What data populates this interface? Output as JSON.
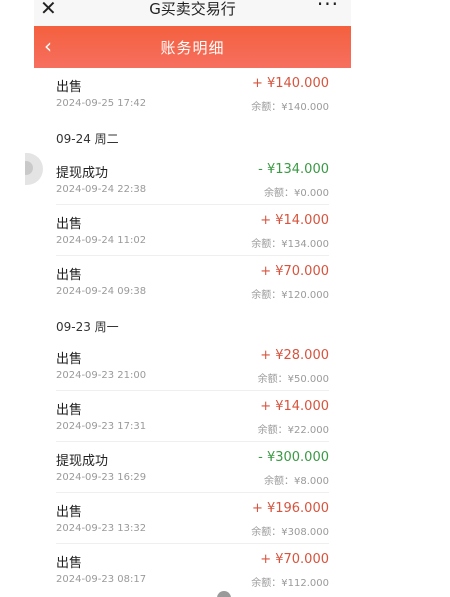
{
  "topbar": {
    "close_icon": "✕",
    "title": "G买卖交易行",
    "more_icon": "···"
  },
  "header": {
    "back_icon": "‹",
    "title": "账务明细"
  },
  "groups": [
    {
      "day": "",
      "records": [
        {
          "label": "出售",
          "date": "2024-09-25 17:42",
          "amount": "+ ¥140.000",
          "balance": "余额：¥140.000",
          "type": "in"
        }
      ]
    },
    {
      "day": "09-24 周二",
      "records": [
        {
          "label": "提现成功",
          "date": "2024-09-24 22:38",
          "amount": "- ¥134.000",
          "balance": "余额：¥0.000",
          "type": "out"
        },
        {
          "label": "出售",
          "date": "2024-09-24 11:02",
          "amount": "+ ¥14.000",
          "balance": "余额：¥134.000",
          "type": "in"
        },
        {
          "label": "出售",
          "date": "2024-09-24 09:38",
          "amount": "+ ¥70.000",
          "balance": "余额：¥120.000",
          "type": "in"
        }
      ]
    },
    {
      "day": "09-23 周一",
      "records": [
        {
          "label": "出售",
          "date": "2024-09-23 21:00",
          "amount": "+ ¥28.000",
          "balance": "余额：¥50.000",
          "type": "in"
        },
        {
          "label": "出售",
          "date": "2024-09-23 17:31",
          "amount": "+ ¥14.000",
          "balance": "余额：¥22.000",
          "type": "in"
        },
        {
          "label": "提现成功",
          "date": "2024-09-23 16:29",
          "amount": "- ¥300.000",
          "balance": "余额：¥8.000",
          "type": "out"
        },
        {
          "label": "出售",
          "date": "2024-09-23 13:32",
          "amount": "+ ¥196.000",
          "balance": "余额：¥308.000",
          "type": "in"
        },
        {
          "label": "出售",
          "date": "2024-09-23 08:17",
          "amount": "+ ¥70.000",
          "balance": "余额：¥112.000",
          "type": "in"
        }
      ]
    }
  ],
  "colors": {
    "header_gradient_top": "#f4603e",
    "income": "#d7543e",
    "withdrawal": "#3a9a44"
  }
}
